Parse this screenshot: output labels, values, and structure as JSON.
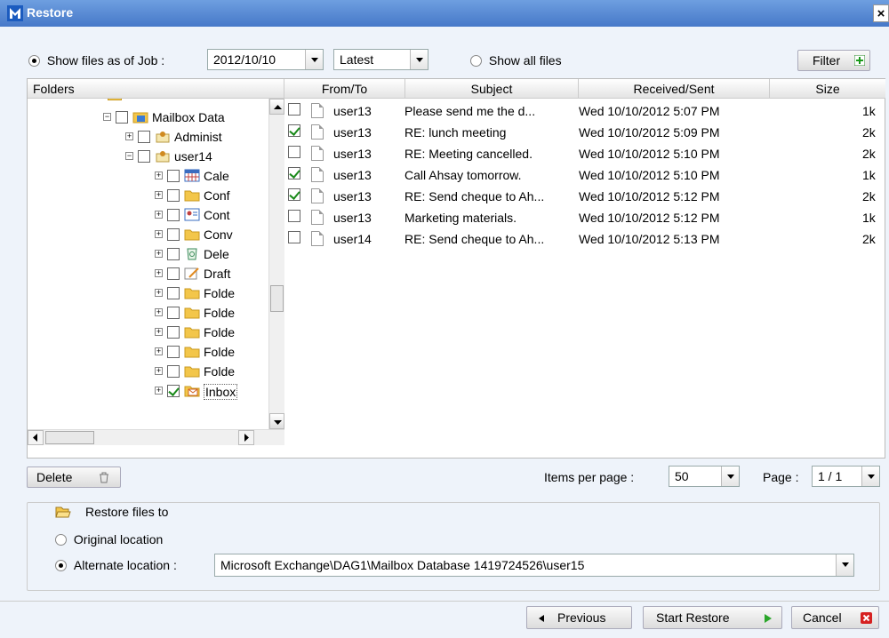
{
  "window": {
    "title": "Restore",
    "close_label": "×"
  },
  "topbar": {
    "show_as_of_job_label": "Show files as of Job :",
    "job_date": "2012/10/10",
    "version": "Latest",
    "show_all_label": "Show all files",
    "filter_label": "Filter"
  },
  "folders": {
    "header": "Folders",
    "nodes": [
      {
        "label": "Mailbox Data"
      },
      {
        "label": "Administ"
      },
      {
        "label": "user14"
      },
      {
        "label": "Cale"
      },
      {
        "label": "Conf"
      },
      {
        "label": "Cont"
      },
      {
        "label": "Conv"
      },
      {
        "label": "Dele"
      },
      {
        "label": "Draft"
      },
      {
        "label": "Folde"
      },
      {
        "label": "Folde"
      },
      {
        "label": "Folde"
      },
      {
        "label": "Folde"
      },
      {
        "label": "Folde"
      },
      {
        "label": "Inbox"
      }
    ]
  },
  "grid": {
    "columns": [
      "From/To",
      "Subject",
      "Received/Sent",
      "Size"
    ],
    "rows": [
      {
        "from": "user13",
        "subject": "Please send me the d...",
        "date": "Wed 10/10/2012 5:07 PM",
        "size": "1k",
        "checked": false
      },
      {
        "from": "user13",
        "subject": "RE: lunch meeting",
        "date": "Wed 10/10/2012 5:09 PM",
        "size": "2k",
        "checked": true
      },
      {
        "from": "user13",
        "subject": "RE: Meeting cancelled.",
        "date": "Wed 10/10/2012 5:10 PM",
        "size": "2k",
        "checked": false
      },
      {
        "from": "user13",
        "subject": "Call Ahsay tomorrow.",
        "date": "Wed 10/10/2012 5:10 PM",
        "size": "1k",
        "checked": true
      },
      {
        "from": "user13",
        "subject": "RE: Send cheque to Ah...",
        "date": "Wed 10/10/2012 5:12 PM",
        "size": "2k",
        "checked": true
      },
      {
        "from": "user13",
        "subject": "Marketing materials.",
        "date": "Wed 10/10/2012 5:12 PM",
        "size": "1k",
        "checked": false
      },
      {
        "from": "user14",
        "subject": "RE: Send cheque to Ah...",
        "date": "Wed 10/10/2012 5:13 PM",
        "size": "2k",
        "checked": false
      }
    ]
  },
  "bottom": {
    "delete_label": "Delete",
    "items_per_page_label": "Items per page :",
    "items_per_page": "50",
    "page_label": "Page :",
    "page_value": "1 / 1"
  },
  "restore": {
    "heading": "Restore files to",
    "original_label": "Original location",
    "alternate_label": "Alternate location :",
    "alternate_path": "Microsoft Exchange\\DAG1\\Mailbox Database 1419724526\\user15"
  },
  "footer": {
    "previous_label": "Previous",
    "start_label": "Start Restore",
    "cancel_label": "Cancel"
  }
}
